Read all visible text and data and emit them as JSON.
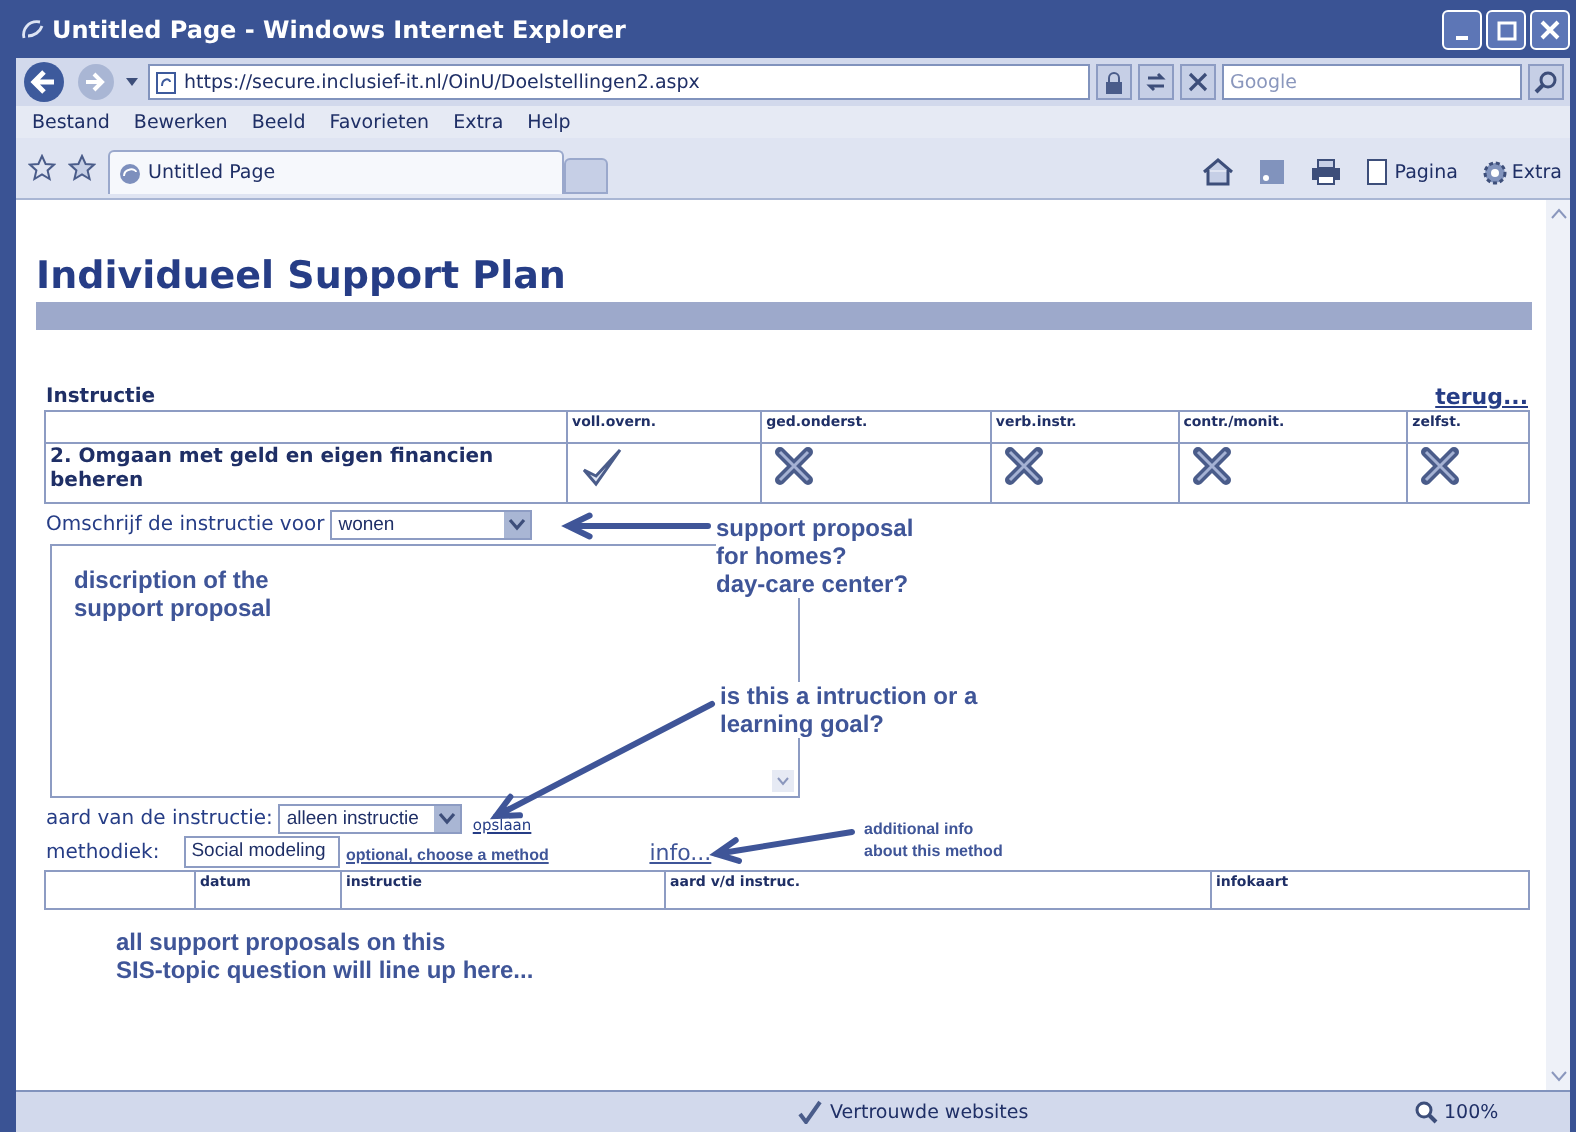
{
  "window": {
    "title": "Untitled Page - Windows Internet Explorer"
  },
  "address_bar": {
    "url": "https://secure.inclusief-it.nl/OinU/Doelstellingen2.aspx"
  },
  "search": {
    "placeholder": "Google"
  },
  "menu": [
    "Bestand",
    "Bewerken",
    "Beeld",
    "Favorieten",
    "Extra",
    "Help"
  ],
  "tabs": [
    {
      "label": "Untitled Page",
      "selected": true
    }
  ],
  "toolbar": [
    "Pagina",
    "Extra"
  ],
  "page": {
    "heading": "Individueel Support Plan",
    "section_title": "Instructie",
    "back_link": "terug...",
    "matrix": {
      "columns": [
        "voll.overn.",
        "ged.onderst.",
        "verb.instr.",
        "contr./monit.",
        "zelfst."
      ],
      "rows": [
        {
          "label": "2. Omgaan met geld en eigen financien beheren",
          "marks": [
            {
              "checked": true
            },
            {
              "checked": false
            },
            {
              "checked": false
            },
            {
              "checked": false
            },
            {
              "checked": false
            }
          ]
        }
      ]
    },
    "describe_label": "Omschrijf de instructie voor",
    "describe_select": "wonen",
    "type_label": "aard van de instructie:",
    "type_select": "alleen instructie",
    "save_link": "opslaan",
    "method_label": "methodiek:",
    "method_value": "Social modeling",
    "info_link": "info...",
    "list_columns": [
      "datum",
      "instructie",
      "aard v/d instruc.",
      "infokaart"
    ]
  },
  "annotations": [
    {
      "kind": "callout",
      "text": "support proposal\nfor homes?\nday-care center?"
    },
    {
      "kind": "note",
      "text": "discription of the\nsupport proposal"
    },
    {
      "kind": "callout",
      "text": "is this a intruction or a\nlearning goal?"
    },
    {
      "kind": "tag",
      "text": "optional, choose a method"
    },
    {
      "kind": "small-callout",
      "text": "additional info\nabout this method"
    },
    {
      "kind": "note",
      "text": "all support proposals on this\nSIS-topic question will line up here..."
    }
  ],
  "status_bar": {
    "zone": "Vertrouwde websites",
    "zoom": "100%"
  }
}
